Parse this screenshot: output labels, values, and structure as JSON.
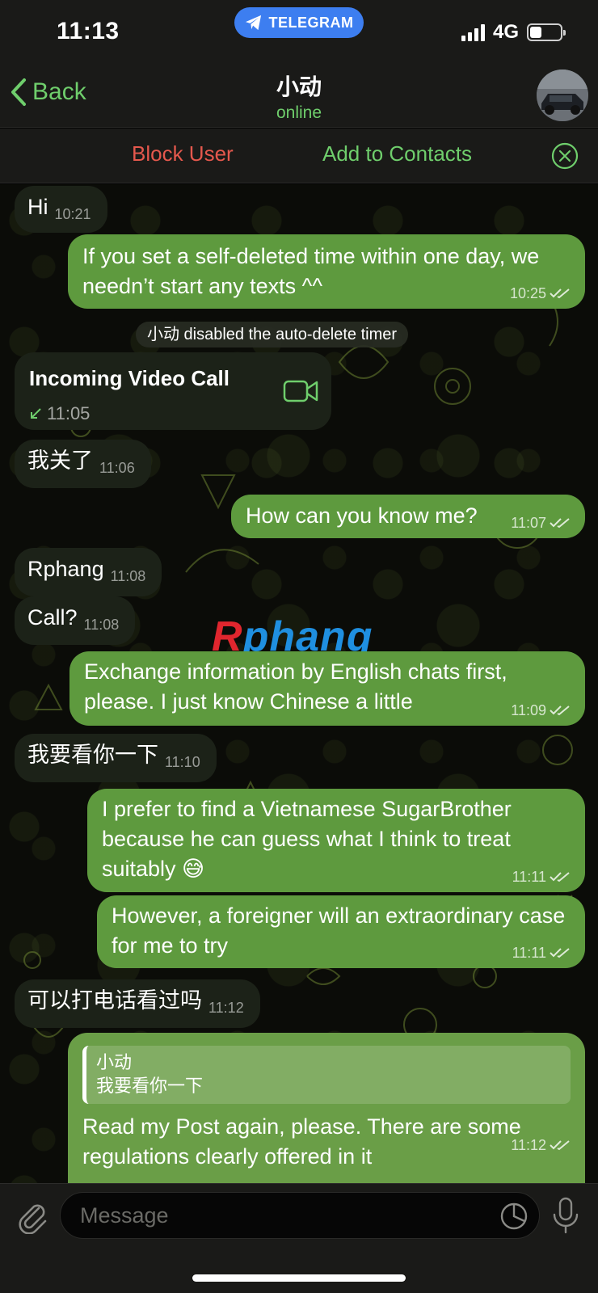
{
  "status_bar": {
    "time": "11:13",
    "app_pill": "TELEGRAM",
    "network": "4G"
  },
  "header": {
    "back_label": "Back",
    "contact_name": "小动",
    "status": "online"
  },
  "actions": {
    "block_label": "Block User",
    "add_label": "Add to Contacts"
  },
  "messages": {
    "m1": {
      "text": "Hi",
      "time": "10:21"
    },
    "m2": {
      "text": "If you set a self-deleted time within one day, we needn’t start any texts ^^",
      "time": "10:25"
    },
    "service": "小动 disabled the auto-delete timer",
    "call": {
      "title": "Incoming Video Call",
      "time": "11:05"
    },
    "m3": {
      "text": "我关了",
      "time": "11:06"
    },
    "m4": {
      "text": "How can you know me?",
      "time": "11:07"
    },
    "m5": {
      "text": "Rphang",
      "time": "11:08"
    },
    "m6": {
      "text": "Call?",
      "time": "11:08"
    },
    "m7": {
      "text": "Exchange information by English chats first, please. I just know Chinese a little",
      "time": "11:09"
    },
    "m8": {
      "text": "我要看你一下",
      "time": "11:10"
    },
    "m9": {
      "text": "I prefer to find a Vietnamese SugarBrother because he can guess what I think to treat suitably 😅",
      "time": "11:11"
    },
    "m10": {
      "text": "However, a foreigner will an extraordinary case for me to try",
      "time": "11:11"
    },
    "m11": {
      "text": "可以打电话看过吗",
      "time": "11:12"
    },
    "m12": {
      "reply_name": "小动",
      "reply_text": "我要看你一下",
      "text": "Read my Post again, please. There are some regulations clearly offered in it",
      "time": "11:12"
    }
  },
  "watermark": {
    "first": "R",
    "rest": "phang"
  },
  "composer": {
    "placeholder": "Message"
  },
  "colors": {
    "accent_green": "#6fce6c",
    "outgoing_bubble": "#5e9a3e",
    "incoming_bubble": "#1c2218",
    "block_red": "#e5584d",
    "telegram_blue": "#3d7ef0"
  },
  "icons": [
    "telegram-plane-icon",
    "chevron-left-icon",
    "close-circle-icon",
    "video-camera-icon",
    "arrow-incoming-icon",
    "double-check-icon",
    "paperclip-icon",
    "sticker-icon",
    "microphone-icon"
  ]
}
